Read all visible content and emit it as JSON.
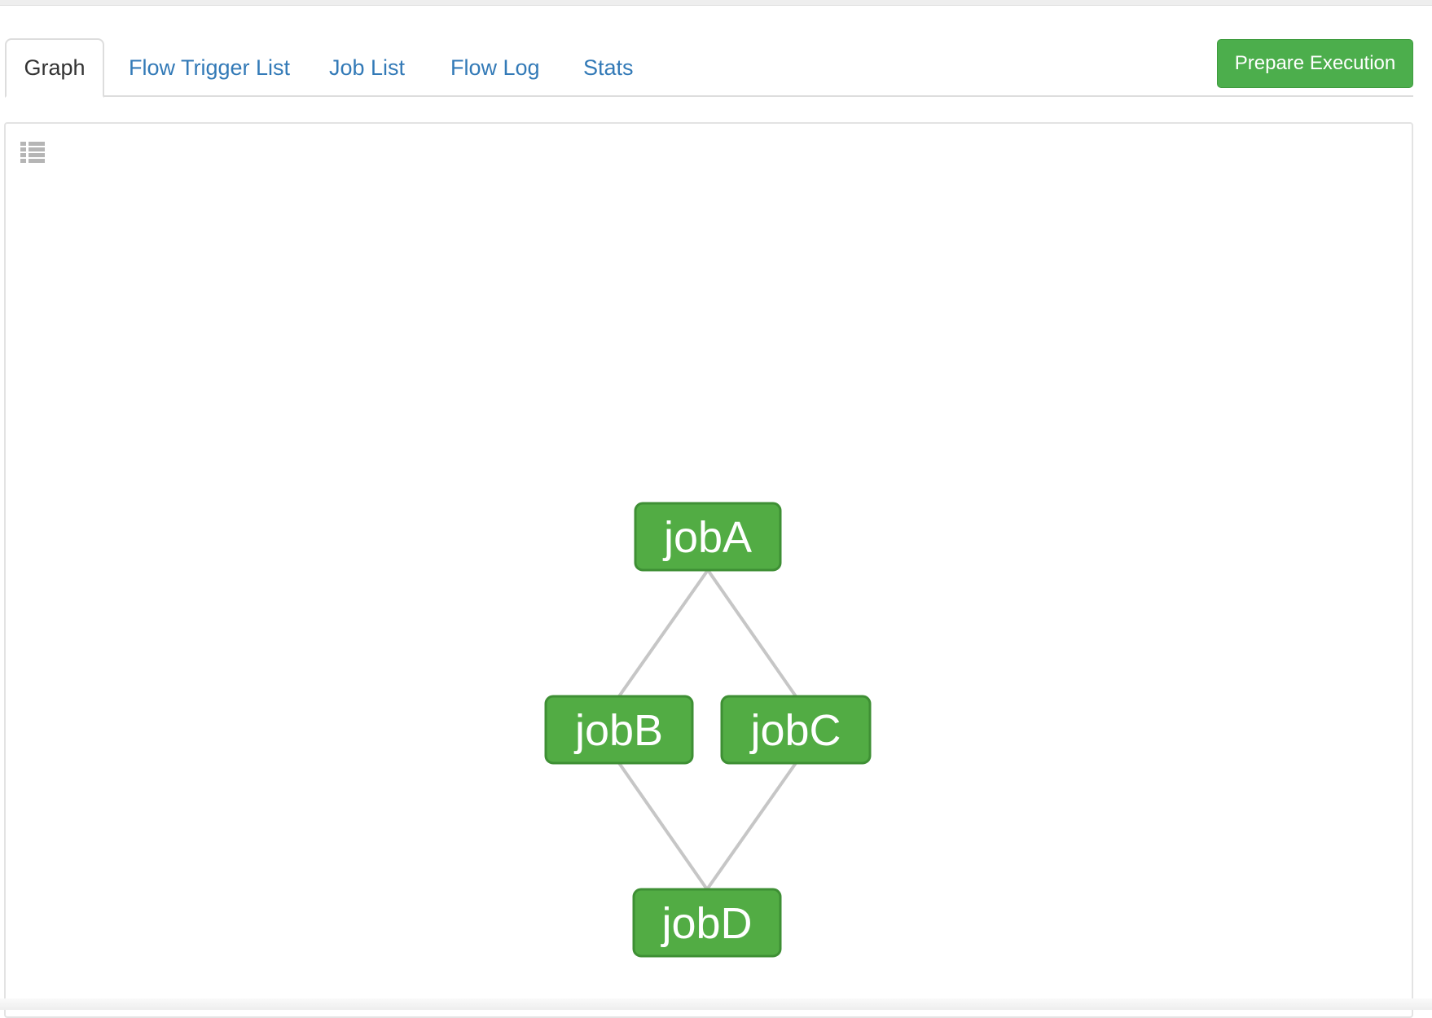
{
  "tabs": [
    {
      "label": "Graph",
      "active": true
    },
    {
      "label": "Flow Trigger List",
      "active": false
    },
    {
      "label": "Job List",
      "active": false
    },
    {
      "label": "Flow Log",
      "active": false
    },
    {
      "label": "Stats",
      "active": false
    }
  ],
  "actions": {
    "prepare_execution_label": "Prepare Execution"
  },
  "graph": {
    "toolbar_icon": "list-icon",
    "node_color": "#52ac44",
    "node_border_color": "#3e8f34",
    "edge_color": "#c6c6c6",
    "nodes": [
      {
        "id": "jobA",
        "label": "jobA"
      },
      {
        "id": "jobB",
        "label": "jobB"
      },
      {
        "id": "jobC",
        "label": "jobC"
      },
      {
        "id": "jobD",
        "label": "jobD"
      }
    ],
    "edges": [
      {
        "from": "jobA",
        "to": "jobB"
      },
      {
        "from": "jobA",
        "to": "jobC"
      },
      {
        "from": "jobB",
        "to": "jobD"
      },
      {
        "from": "jobC",
        "to": "jobD"
      }
    ]
  }
}
